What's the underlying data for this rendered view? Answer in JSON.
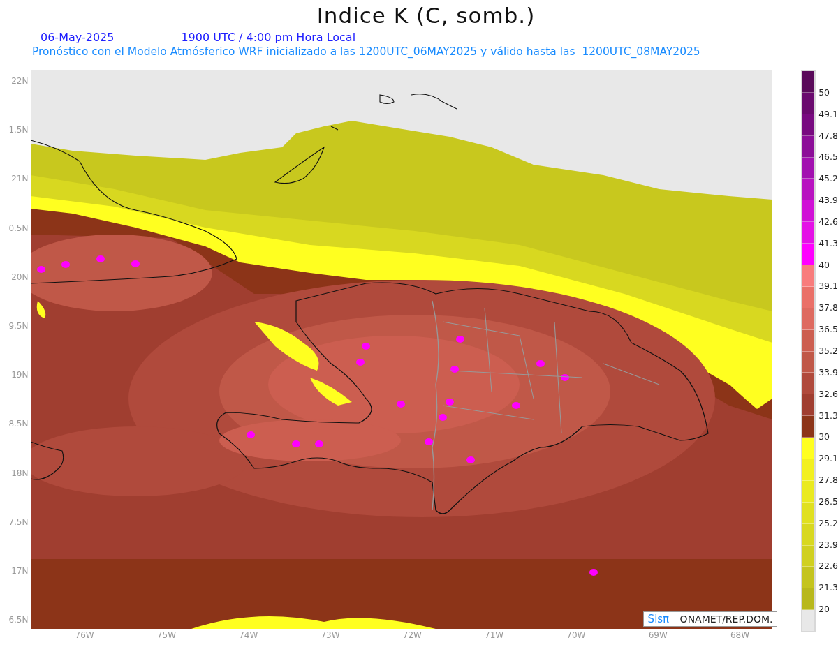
{
  "title": "Indice K (C, somb.)",
  "date": "06-May-2025",
  "time": "1900 UTC / 4:00 pm Hora Local",
  "subtitle": "Pronóstico con el Modelo Atmósferico WRF inicializado a las 1200UTC_06MAY2025 y válido hasta las  1200UTC_08MAY2025",
  "map": {
    "lat_labels": [
      "22N",
      "1.5N",
      "21N",
      "0.5N",
      "20N",
      "9.5N",
      "19N",
      "8.5N",
      "18N",
      "7.5N",
      "17N",
      "6.5N"
    ],
    "lon_labels": [
      "76W",
      "75W",
      "74W",
      "73W",
      "72W",
      "71W",
      "70W",
      "69W",
      "68W"
    ],
    "credit": {
      "logo": "Sisπ",
      "text": "– ONAMET/REP.DOM."
    }
  },
  "legend": [
    {
      "color": "#5a0a5a",
      "label": "50"
    },
    {
      "color": "#6a0a6e",
      "label": "49.1"
    },
    {
      "color": "#780a80",
      "label": "47.8"
    },
    {
      "color": "#8c0e98",
      "label": "46.5"
    },
    {
      "color": "#a210b0",
      "label": "45.2"
    },
    {
      "color": "#b812c0",
      "label": "43.9"
    },
    {
      "color": "#d010d6",
      "label": "42.6"
    },
    {
      "color": "#e410e6",
      "label": "41.3"
    },
    {
      "color": "#ff00ff",
      "label": "40"
    },
    {
      "color": "#f87c7c",
      "label": "39.1"
    },
    {
      "color": "#ea7068",
      "label": "37.8"
    },
    {
      "color": "#de6a60",
      "label": "36.5"
    },
    {
      "color": "#cc5e50",
      "label": "35.2"
    },
    {
      "color": "#c05848",
      "label": "33.9"
    },
    {
      "color": "#b04a3c",
      "label": "32.6"
    },
    {
      "color": "#a03e30",
      "label": "31.3"
    },
    {
      "color": "#8c3418",
      "label": "30"
    },
    {
      "color": "#ffff20",
      "label": "29.1"
    },
    {
      "color": "#f2f020",
      "label": "27.8"
    },
    {
      "color": "#eaea20",
      "label": "26.5"
    },
    {
      "color": "#e0e020",
      "label": "25.2"
    },
    {
      "color": "#d8d820",
      "label": "23.9"
    },
    {
      "color": "#d0d020",
      "label": "22.6"
    },
    {
      "color": "#c4c41e",
      "label": "21.3"
    },
    {
      "color": "#b8b81c",
      "label": "20"
    },
    {
      "color": "#e8e8e8"
    }
  ]
}
